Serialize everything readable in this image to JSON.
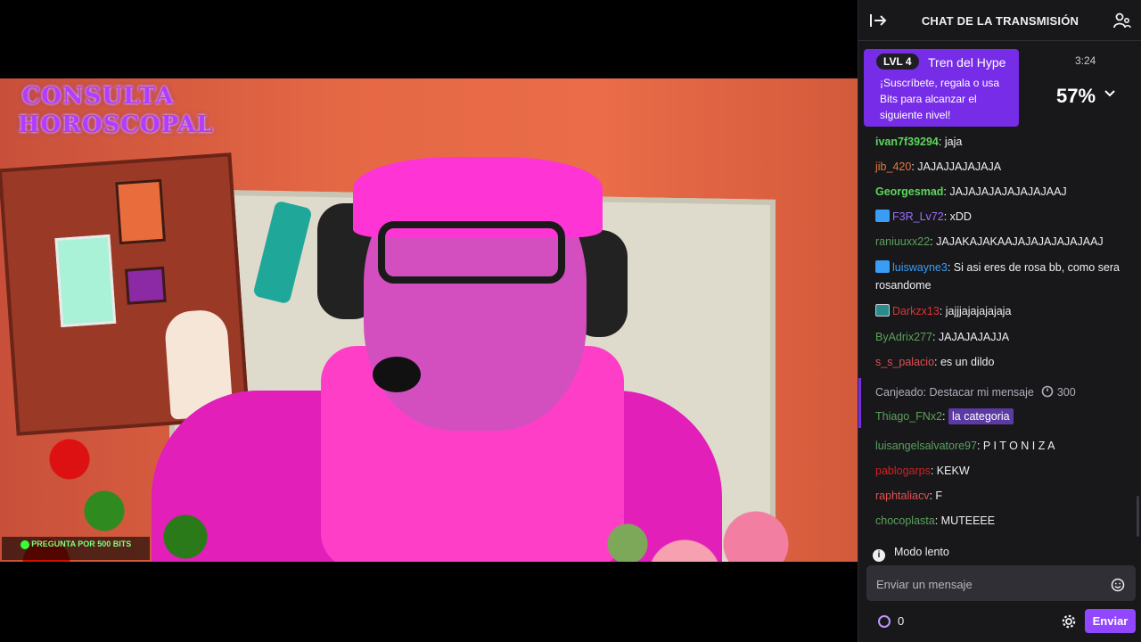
{
  "chat": {
    "title": "CHAT DE LA TRANSMISIÓN",
    "hype_train": {
      "level": "LVL 4",
      "name": "Tren del Hype",
      "description": "¡Suscríbete, regala o usa Bits para alcanzar el siguiente nivel!",
      "timer": "3:24",
      "percent": "57%",
      "accent": "#772ce8"
    },
    "messages": [
      {
        "user": "ivan7f39294",
        "color": "#5cd65c",
        "text": ": jaja",
        "badge": ""
      },
      {
        "user": "jib_420",
        "color": "#e07840",
        "text": ": JAJAJJAJAJAJA",
        "badge": ""
      },
      {
        "user": "Georgesmad",
        "color": "#5cd65c",
        "text": ": JAJAJAJAJAJAJAJAAJ",
        "badge": ""
      },
      {
        "user": "F3R_Lv72",
        "color": "#9d6cff",
        "text": ": xDD",
        "badge": "crown"
      },
      {
        "user": "raniuuxx22",
        "color": "#5aa15a",
        "text": ": JAJAKAJAKAAJAJAJAJAJAJAAJ",
        "badge": ""
      },
      {
        "user": "luiswayne3",
        "color": "#3a9df5",
        "text": ": Si asi eres de rosa bb, como sera rosandome",
        "badge": "crown"
      },
      {
        "user": "Darkzx13",
        "color": "#e23030",
        "text": ": jajjjajajajajaja",
        "badge": "sub"
      },
      {
        "user": "ByAdrix277",
        "color": "#5aa15a",
        "text": ": JAJAJAJAJJA",
        "badge": ""
      },
      {
        "user": "s_s_palacio",
        "color": "#e05050",
        "text": ": es un dildo",
        "badge": ""
      }
    ],
    "redemption": {
      "label": "Canjeado: Destacar mi mensaje",
      "cost": "300",
      "user": "Thiago_FNx2",
      "user_color": "#5aa15a",
      "text": "la categoria"
    },
    "messages_after": [
      {
        "user": "luisangelsalvatore97",
        "color": "#5aa15a",
        "text": ": P I T O N I Z A"
      },
      {
        "user": "pablogarps",
        "color": "#d42020",
        "text": ": KEKW"
      },
      {
        "user": "raphtaliacv",
        "color": "#e05050",
        "text": ": F"
      },
      {
        "user": "chocoplasta",
        "color": "#5aa15a",
        "text": ": MUTEEEE"
      }
    ],
    "slow_mode": "Modo lento",
    "input_placeholder": "Enviar un mensaje",
    "points": "0",
    "send_label": "Enviar"
  },
  "stream_overlay": {
    "title": "CONSULTA HOROSCOPAL",
    "bits_banner": "PREGUNTA POR 500 BITS"
  }
}
